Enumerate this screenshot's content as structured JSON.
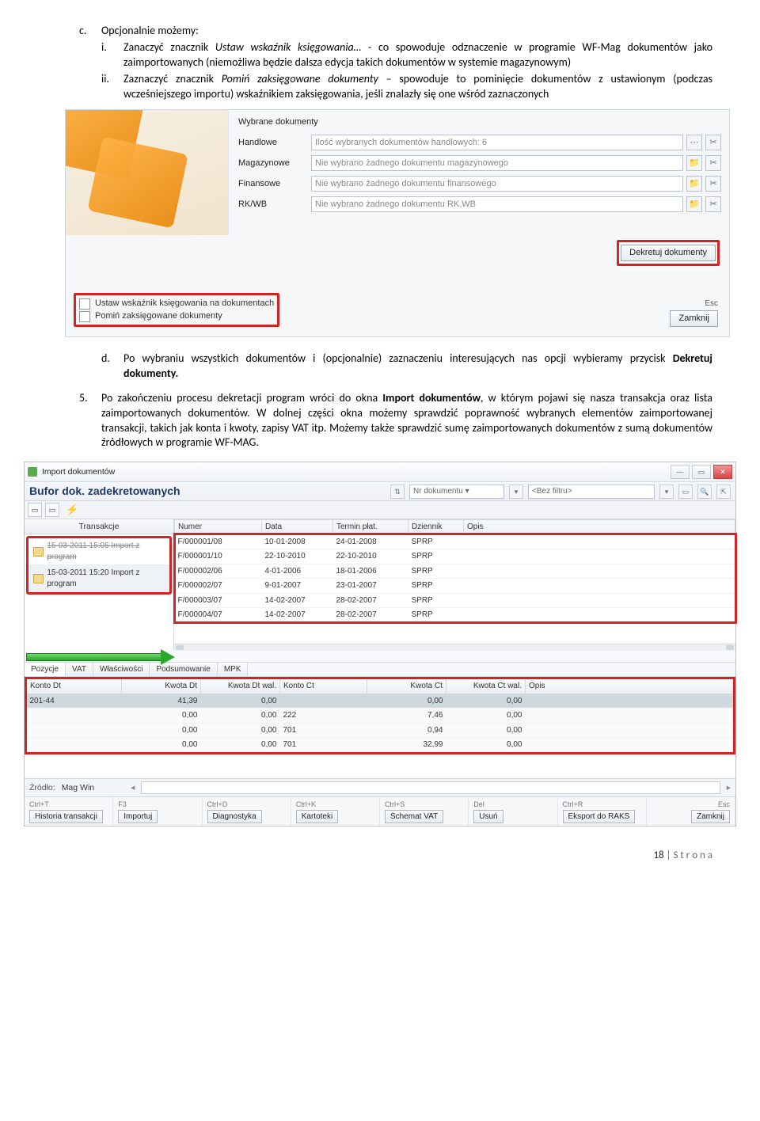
{
  "doc": {
    "c_label": "c.",
    "c_text": "Opcjonalnie możemy:",
    "i_label": "i.",
    "i_text_pre": "Zanaczyć znacznik ",
    "i_text_em": "Ustaw wskaźnik księgowania…",
    "i_text_post": " - co spowoduje odznaczenie w programie WF-Mag dokumentów jako zaimportowanych (niemożliwa będzie dalsza edycja takich dokumentów w systemie magazynowym)",
    "ii_label": "ii.",
    "ii_text_pre": "Zaznaczyć znacznik ",
    "ii_text_em": "Pomiń zaksięgowane dokumenty",
    "ii_text_post": " – spowoduje to pominięcie dokumentów z ustawionym (podczas wcześniejszego importu) wskaźnikiem zaksięgowania, jeśli znalazły się one wśród zaznaczonych",
    "d_label": "d.",
    "d_text_pre": "Po wybraniu wszystkich dokumentów i (opcjonalnie) zaznaczeniu interesujących nas opcji wybieramy przycisk ",
    "d_text_bold": "Dekretuj dokumenty.",
    "n5_label": "5.",
    "n5_text_a": "Po zakończeniu procesu dekretacji program wróci do okna ",
    "n5_text_b": "Import dokumentów",
    "n5_text_c": ", w którym pojawi się nasza transakcja oraz lista zaimportowanych dokumentów. W dolnej części okna możemy sprawdzić poprawność wybranych elementów zaimportowanej transakcji, takich jak konta i kwoty, zapisy VAT itp. Możemy także sprawdzić sumę zaimportowanych dokumentów z sumą dokumentów źródłowych w programie WF-MAG."
  },
  "scr1": {
    "heading": "Wybrane dokumenty",
    "rows": [
      {
        "label": "Handlowe",
        "value": "Ilość wybranych dokumentów handlowych: 6"
      },
      {
        "label": "Magazynowe",
        "value": "Nie wybrano żadnego dokumentu magazynowego"
      },
      {
        "label": "Finansowe",
        "value": "Nie wybrano żadnego dokumentu finansowego"
      },
      {
        "label": "RK/WB",
        "value": "Nie wybrano żadnego dokumentu RK,WB"
      }
    ],
    "dekret": "Dekretuj dokumenty",
    "check1": "Ustaw wskaźnik księgowania na dokumentach",
    "check2": "Pomiń zaksięgowane dokumenty",
    "esc": "Esc",
    "close": "Zamknij"
  },
  "scr2": {
    "title": "Import dokumentów",
    "bufor": "Bufor dok. zadekretowanych",
    "sort_label": "Nr dokumentu",
    "filter_ph": "<Bez filtru>",
    "trans_header": "Transakcje",
    "trans_prev": "15-03-2011 15:05 Import z program",
    "trans_sel": "15-03-2011 15:20 Import z program",
    "cols": [
      "Numer",
      "Data",
      "Termin płat.",
      "Dziennik",
      "Opis"
    ],
    "rows": [
      [
        "F/000001/08",
        "10-01-2008",
        "24-01-2008",
        "SPRP",
        ""
      ],
      [
        "F/000001/10",
        "22-10-2010",
        "22-10-2010",
        "SPRP",
        ""
      ],
      [
        "F/000002/06",
        "4-01-2006",
        "18-01-2006",
        "SPRP",
        ""
      ],
      [
        "F/000002/07",
        "9-01-2007",
        "23-01-2007",
        "SPRP",
        ""
      ],
      [
        "F/000003/07",
        "14-02-2007",
        "28-02-2007",
        "SPRP",
        ""
      ],
      [
        "F/000004/07",
        "14-02-2007",
        "28-02-2007",
        "SPRP",
        ""
      ]
    ],
    "tabs": [
      "Pozycje",
      "VAT",
      "Właściwości",
      "Podsumowanie",
      "MPK"
    ],
    "cols2": [
      "Konto Dt",
      "Kwota Dt",
      "Kwota Dt wal.",
      "Konto Ct",
      "Kwota Ct",
      "Kwota Ct wal.",
      "Opis"
    ],
    "rows2": [
      [
        "201-44",
        "41,39",
        "0,00",
        "",
        "0,00",
        "0,00",
        ""
      ],
      [
        "",
        "0,00",
        "0,00",
        "222",
        "7,46",
        "0,00",
        ""
      ],
      [
        "",
        "0,00",
        "0,00",
        "701",
        "0,94",
        "0,00",
        ""
      ],
      [
        "",
        "0,00",
        "0,00",
        "701",
        "32,99",
        "0,00",
        ""
      ]
    ],
    "src_label": "Źródło:",
    "src_value": "Mag Win",
    "shortcuts": [
      {
        "hint": "Ctrl+T",
        "label": "Historia transakcji"
      },
      {
        "hint": "F3",
        "label": "Importuj"
      },
      {
        "hint": "Ctrl+D",
        "label": "Diagnostyka"
      },
      {
        "hint": "Ctrl+K",
        "label": "Kartoteki"
      },
      {
        "hint": "Ctrl+S",
        "label": "Schemat VAT"
      },
      {
        "hint": "Del",
        "label": "Usuń"
      },
      {
        "hint": "Ctrl+R",
        "label": "Eksport do RAKS"
      },
      {
        "hint": "Esc",
        "label": "Zamknij"
      }
    ]
  },
  "footer": {
    "num": "18",
    "rest": " | S t r o n a"
  }
}
